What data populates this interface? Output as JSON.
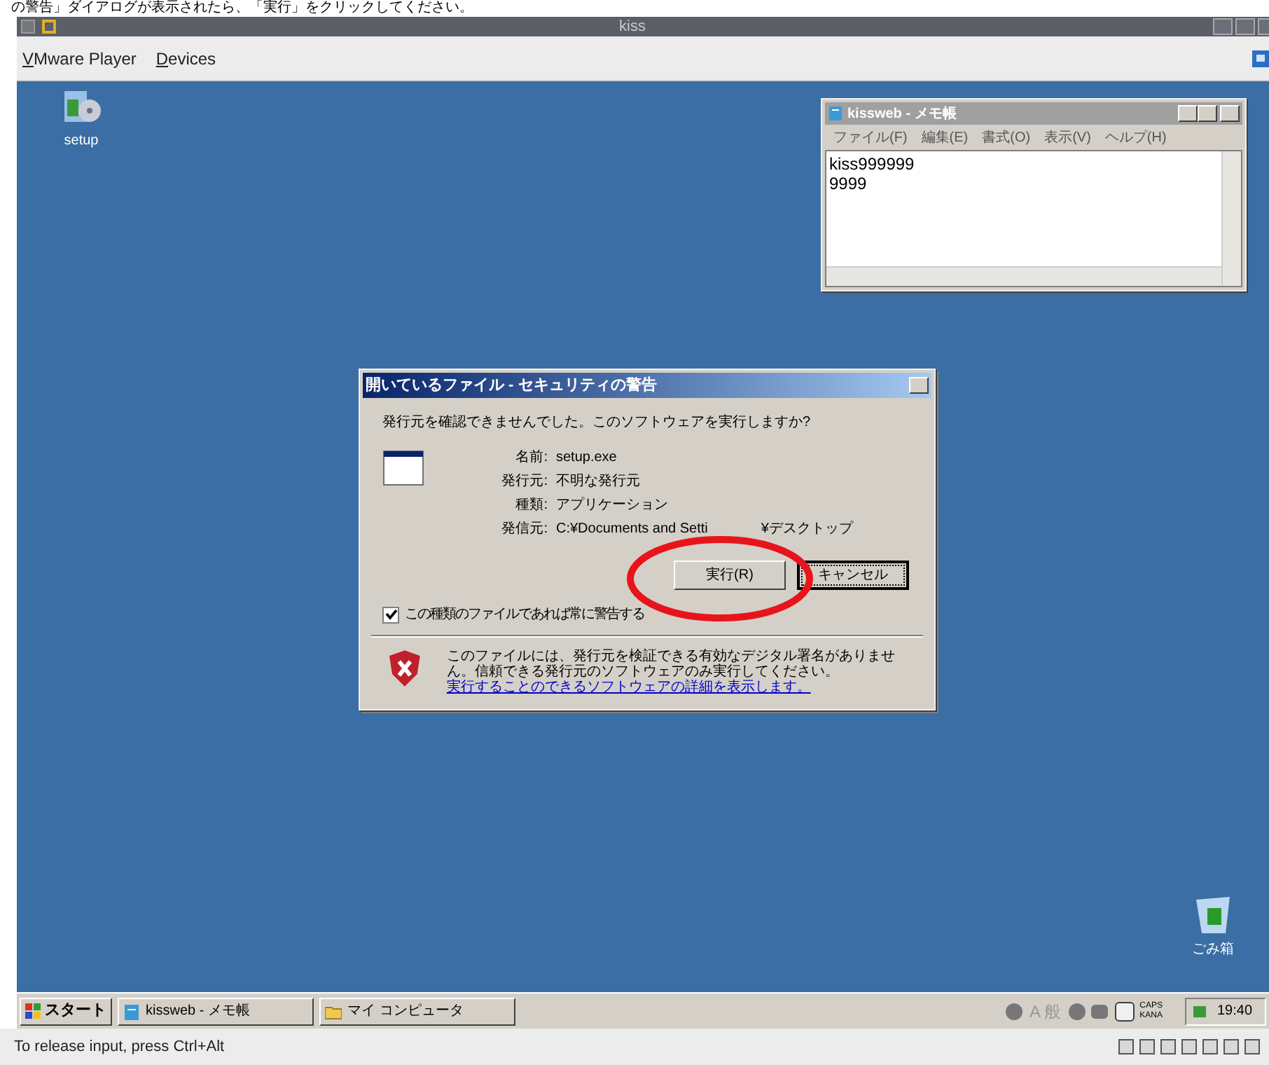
{
  "caption": "の警告」ダイアログが表示されたら、「実行」をクリックしてください。",
  "vm": {
    "title": "kiss",
    "menu": [
      "VMware Player",
      "Devices"
    ]
  },
  "desktop_icons": [
    {
      "label": "setup",
      "kind": "installer"
    },
    {
      "label": "ごみ箱",
      "kind": "recycle-bin"
    }
  ],
  "notepad": {
    "title": "kissweb - メモ帳",
    "menu": [
      "ファイル(F)",
      "編集(E)",
      "書式(O)",
      "表示(V)",
      "ヘルプ(H)"
    ],
    "lines": [
      "kiss999999",
      "9999"
    ]
  },
  "dialog": {
    "title": "開いているファイル - セキュリティの警告",
    "question": "発行元を確認できませんでした。このソフトウェアを実行しますか?",
    "fields": [
      {
        "label": "名前:",
        "value": "setup.exe"
      },
      {
        "label": "発行元:",
        "value": "不明な発行元"
      },
      {
        "label": "種類:",
        "value": "アプリケーション"
      },
      {
        "label": "発信元:",
        "value": "C:¥Documents and Setti",
        "value_end": "¥デスクトップ"
      }
    ],
    "buttons": [
      {
        "label": "実行(R)",
        "focused": false
      },
      {
        "label": "キャンセル",
        "focused": true
      }
    ],
    "checkbox": {
      "label": "この種類のファイルであれば常に警告する",
      "checked": true
    },
    "warning": "このファイルには、発行元を検証できる有効なデジタル署名がありません。信頼できる発行元のソフトウェアのみ実行してください。",
    "link": "実行することのできるソフトウェアの詳細を表示します。"
  },
  "annotation": {
    "kind": "ellipse"
  },
  "taskbar": {
    "start": "スタート",
    "tasks": [
      {
        "label": "kissweb - メモ帳",
        "kind": "notepad",
        "selected": false
      },
      {
        "label": "マイ コンピュータ",
        "kind": "folder",
        "selected": false
      }
    ],
    "ime": "A 般",
    "caps": "CAPS",
    "kana": "KANA",
    "clock": "19:40"
  },
  "status": "To release input, press Ctrl+Alt"
}
